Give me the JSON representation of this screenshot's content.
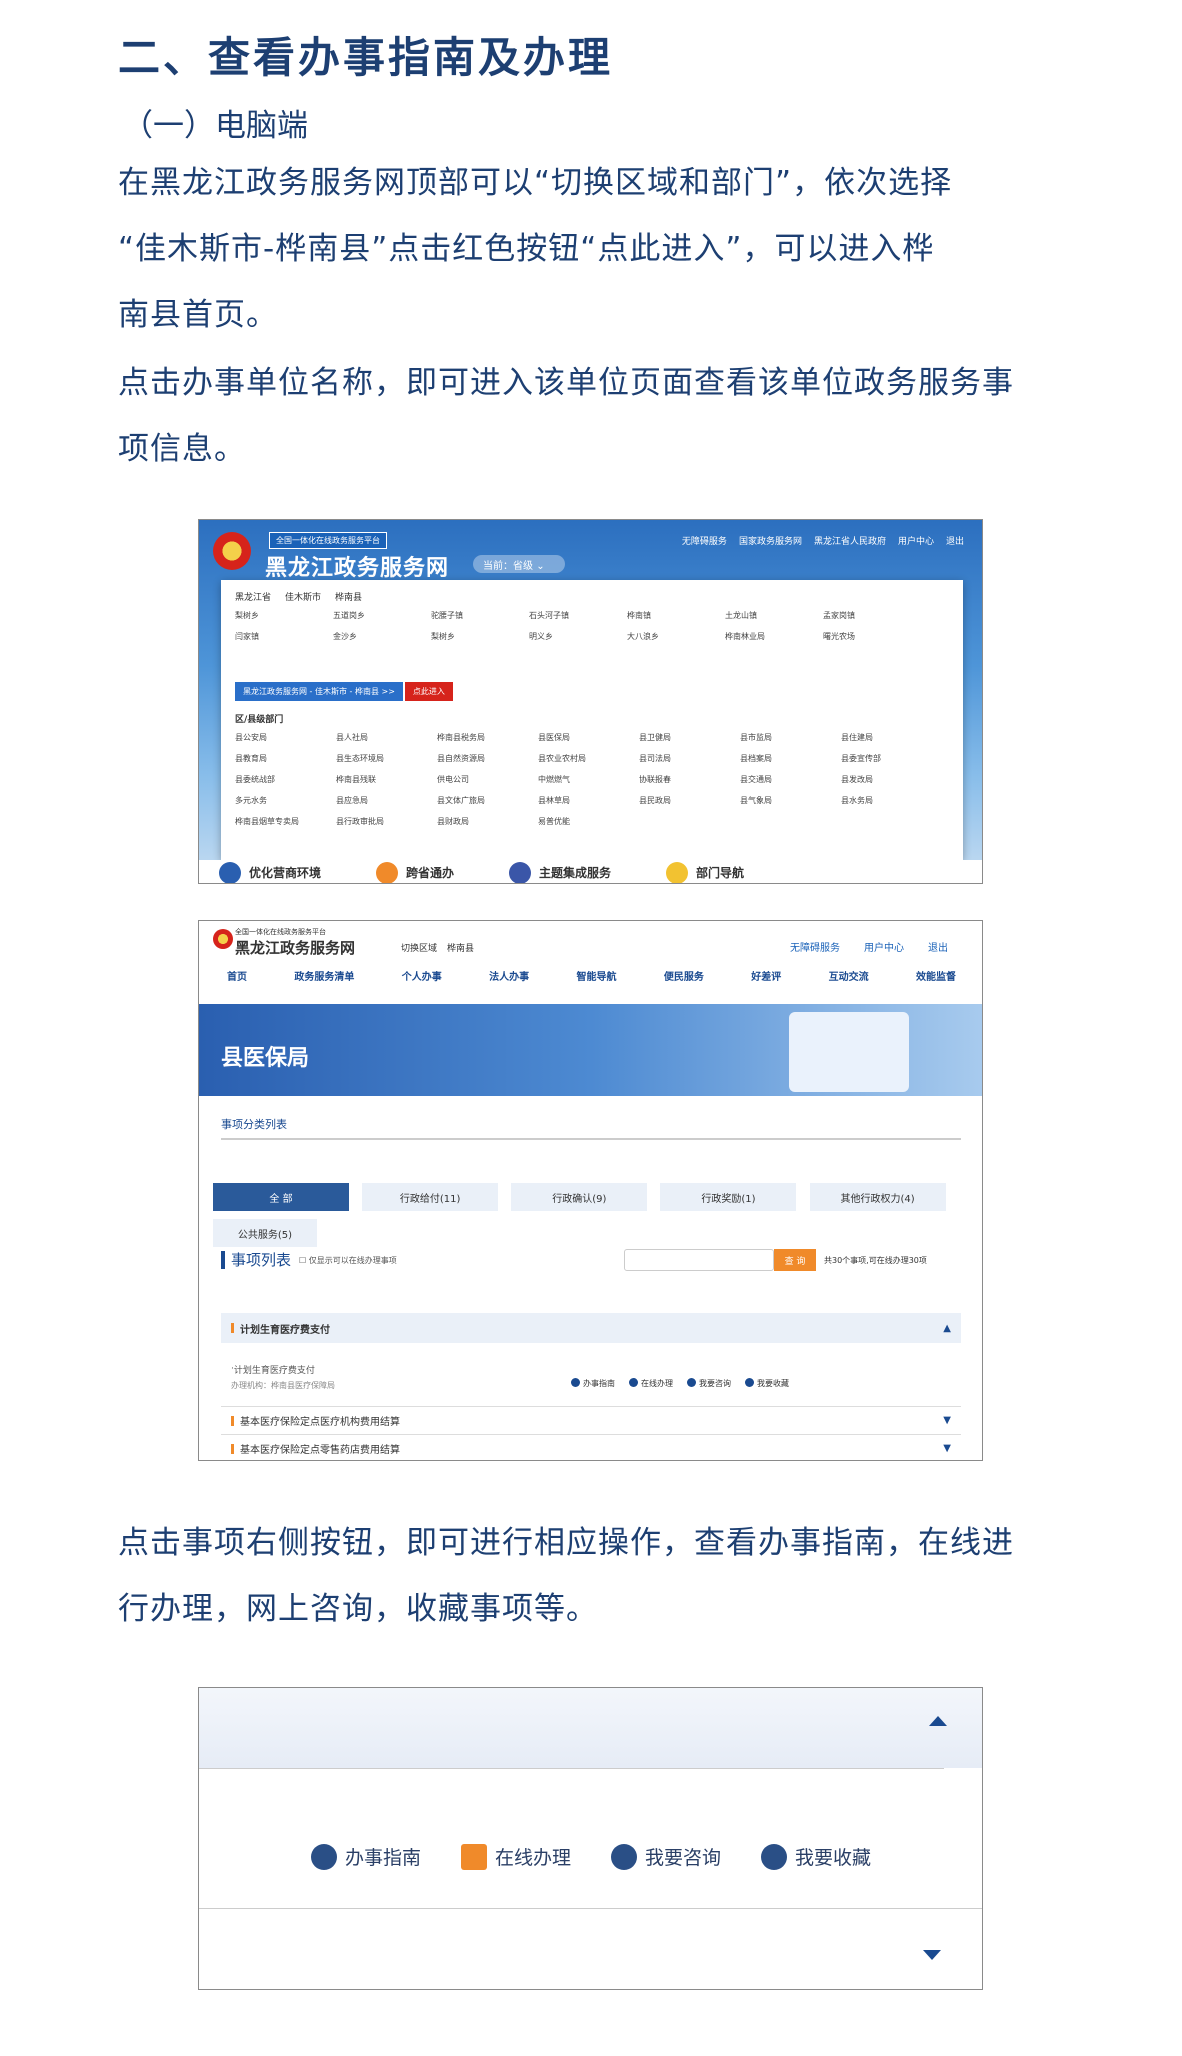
{
  "heading": "二、查看办事指南及办理",
  "subheading": "（一）电脑端",
  "paragraph1": {
    "line1": "在黑龙江政务服务网顶部可以“切换区域和部门”，依次选择",
    "line2": "“佳木斯市-桦南县”点击红色按钮“点此进入”，可以进入桦",
    "line3": "南县首页。"
  },
  "paragraph2": {
    "line1": "点击办事单位名称，即可进入该单位页面查看该单位政务服务事",
    "line2": "项信息。"
  },
  "screenshot1": {
    "platform_label": "全国一体化在线政务服务平台",
    "site_title": "黑龙江政务服务网",
    "region_label": "当前：省级",
    "top_links": [
      "无障碍服务",
      "国家政务服务网",
      "黑龙江省人民政府",
      "用户中心",
      "退出"
    ],
    "breadcrumb": [
      "黑龙江省",
      "佳木斯市",
      "桦南县"
    ],
    "towns": [
      "梨树乡",
      "五道岗乡",
      "驼腰子镇",
      "石头河子镇",
      "桦南镇",
      "土龙山镇",
      "孟家岗镇",
      "闫家镇",
      "金沙乡",
      "梨树乡",
      "明义乡",
      "大八浪乡",
      "桦南林业局",
      "曙光农场"
    ],
    "enter_path": "黑龙江政务服务网 - 佳木斯市 - 桦南县 >>",
    "enter_button": "点此进入",
    "dept_category": "区/县级部门",
    "departments": [
      "县公安局",
      "县人社局",
      "桦南县税务局",
      "县医保局",
      "县卫健局",
      "县市监局",
      "县住建局",
      "县教育局",
      "县生态环境局",
      "县自然资源局",
      "县农业农村局",
      "县司法局",
      "县档案局",
      "县委宣传部",
      "县委统战部",
      "桦南县残联",
      "供电公司",
      "中燃燃气",
      "协联报春",
      "县交通局",
      "县发改局",
      "多元水务",
      "县应急局",
      "县文体广旅局",
      "县林草局",
      "县民政局",
      "县气象局",
      "县水务局",
      "桦南县烟草专卖局",
      "县行政审批局",
      "县财政局",
      "易普优能"
    ],
    "bottom_items": [
      "优化营商环境",
      "跨省通办",
      "主题集成服务",
      "部门导航"
    ]
  },
  "screenshot2": {
    "platform_label": "全国一体化在线政务服务平台",
    "site_title": "黑龙江政务服务网",
    "region_switch": "切换区域",
    "region_current": "桦南县",
    "top_right": [
      "无障碍服务",
      "用户中心",
      "退出"
    ],
    "nav": [
      "首页",
      "政务服务清单",
      "个人办事",
      "法人办事",
      "智能导航",
      "便民服务",
      "好差评",
      "互动交流",
      "效能监督"
    ],
    "banner_title": "县医保局",
    "section_title": "事项分类列表",
    "tabs": [
      "全 部",
      "行政给付(11)",
      "行政确认(9)",
      "行政奖励(1)",
      "其他行政权力(4)",
      "公共服务(5)"
    ],
    "list_title": "事项列表",
    "checkbox_label": "仅显示可以在线办理事项",
    "search_button": "查 询",
    "count_text": "共30个事项,可在线办理30项",
    "item1_title": "计划生育医疗费支付",
    "item1_sub": "计划生育医疗费支付",
    "item1_org": "办理机构：桦南县医疗保障局",
    "item1_actions": [
      "办事指南",
      "在线办理",
      "我要咨询",
      "我要收藏"
    ],
    "item2_title": "基本医疗保险定点医疗机构费用结算",
    "item3_title": "基本医疗保险定点零售药店费用结算"
  },
  "paragraph3": {
    "line1": "点击事项右侧按钮，即可进行相应操作，查看办事指南，在线进",
    "line2": "行办理，网上咨询，收藏事项等。"
  },
  "screenshot3": {
    "actions": [
      "办事指南",
      "在线办理",
      "我要咨询",
      "我要收藏"
    ]
  }
}
